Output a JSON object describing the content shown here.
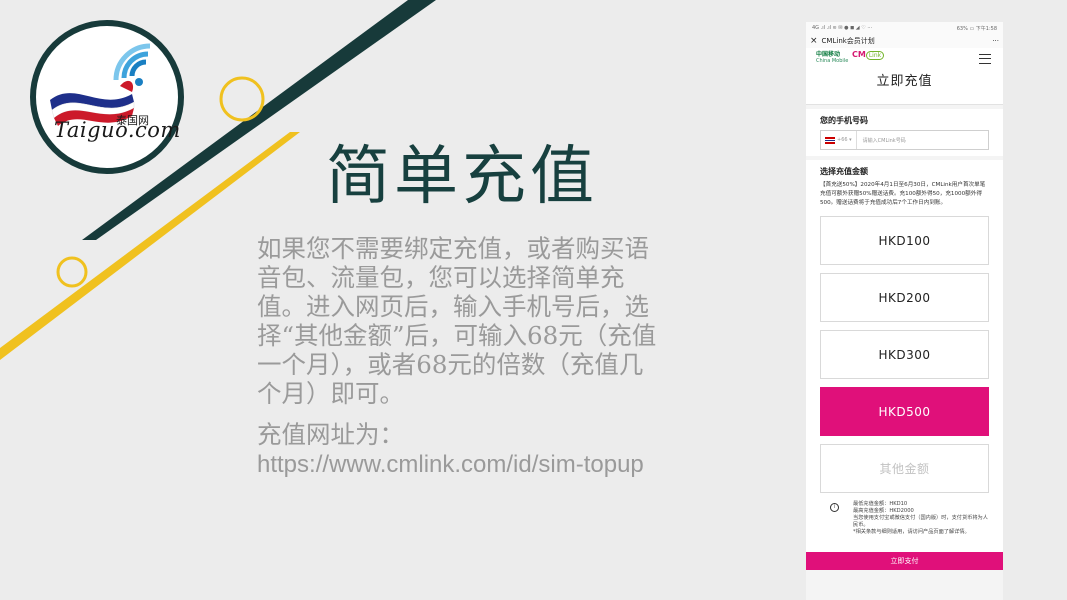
{
  "slide": {
    "title": "简单充值",
    "body_paragraph_1": "如果您不需要绑定充值，或者购买语音包、流量包，您可以选择简单充值。进入网页后，输入手机号后，选择“其他金额”后，可输入68元（充值一个月），或者68元的倍数（充值几个月）即可。",
    "body_paragraph_2_label": "充值网址为：",
    "body_paragraph_2_url": "https://www.cmlink.com/id/sim-topup"
  },
  "logo": {
    "cn": "泰国网",
    "en": "Taiguo.com"
  },
  "phone": {
    "status_left": "4G .ıl .ıl ≋ ✉ ● ◼ ◢ ♡ ···",
    "status_right": "63% ▭ 下午1:58",
    "nav_close": "×",
    "nav_title": "CMLink会员计划",
    "nav_more": "···",
    "brand_cm_cn": "中国移动",
    "brand_cm_en": "China Mobile",
    "brand_cml": "CM",
    "brand_cml_link": "Link",
    "page_title": "立即充值",
    "phone_label": "您的手机号码",
    "country_code": "+66 ▾",
    "phone_placeholder": "请输入CMLink号码",
    "amount_label": "选择充值金额",
    "promo": "【首充送50%】2020年4月1日至6月30日，CMLink用户首次单笔充值可额外获赠50%赠送话费。充100额外得50，充1000额外得500。赠送话费将于充值成功后7个工作日内到账。",
    "amounts": [
      "HKD100",
      "HKD200",
      "HKD300",
      "HKD500"
    ],
    "other_amount": "其他金额",
    "note_line_1": "最低充值金额：HKD10",
    "note_line_2": "最高充值金额：HKD2000",
    "note_line_3": "当您使用支付宝或微信支付（国内版）时，支付货币将为人民币。",
    "note_line_4": "*相关条款与细则适用，请访问产品页面了解详情。",
    "pay_button": "立即支付",
    "info_icon_glyph": "i"
  },
  "colors": {
    "title": "#17403f",
    "body": "#9a9a9a",
    "accent_yellow": "#f0c11f",
    "dark_line": "#173a3a",
    "magenta": "#e0107a"
  }
}
